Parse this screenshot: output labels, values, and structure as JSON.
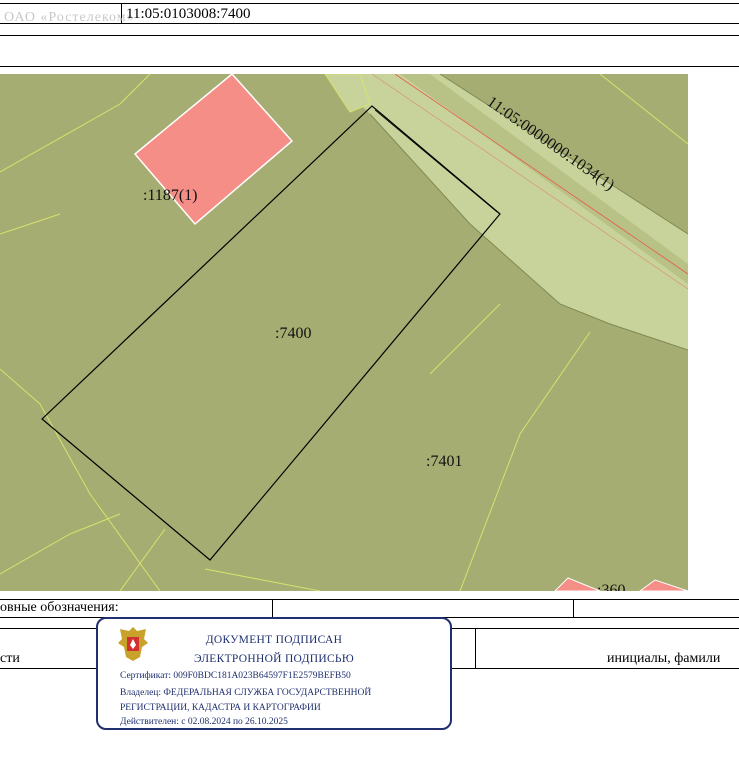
{
  "header": {
    "cadastral_number": "11:05:0103008:7400",
    "faded_text": "ОАО «Ростелеком»"
  },
  "map": {
    "labels": {
      "parcel_1187": ":1187(1)",
      "parcel_7400": ":7400",
      "parcel_7401": ":7401",
      "road": "11:05:0000000:1034(1)",
      "parcel_360": ":360"
    },
    "colors": {
      "background": "#a6ad72",
      "road": "#c8d39b",
      "building": "#f58e86",
      "parcel_line": "#000000",
      "boundary_yellow": "#d7e26c",
      "red_line": "#e85a4a"
    }
  },
  "legend": {
    "label": "овные обозначения:",
    "left_text": "сти",
    "right_text": "инициалы, фамили"
  },
  "stamp": {
    "line1": "ДОКУМЕНТ ПОДПИСАН",
    "line2": "ЭЛЕКТРОННОЙ ПОДПИСЬЮ",
    "certificate": "Сертификат: 009F0BDC181A023B64597F1E2579BEFB50",
    "owner_line1": "Владелец: ФЕДЕРАЛЬНАЯ СЛУЖБА ГОСУДАРСТВЕННОЙ",
    "owner_line2": "РЕГИСТРАЦИИ, КАДАСТРА И КАРТОГРАФИИ",
    "valid": "Действителен: с 02.08.2024 по 26.10.2025",
    "border_color": "#1f2f6f",
    "emblem": "russian-eagle-emblem"
  }
}
